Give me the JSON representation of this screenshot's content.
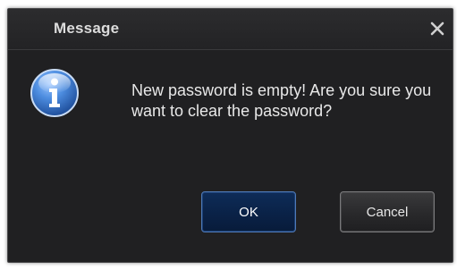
{
  "dialog": {
    "title": "Message",
    "message": "New password is empty! Are you sure you want to clear the password?",
    "icon": "info-icon",
    "close_icon": "close-icon",
    "buttons": {
      "ok_label": "OK",
      "cancel_label": "Cancel"
    }
  },
  "colors": {
    "background": "#202022",
    "title_text": "#dcdcdc",
    "message_text": "#e8e8e8",
    "ok_button": "#0a2247",
    "ok_border": "#4f79b6",
    "cancel_button": "#29292b",
    "info_icon_blue": "#3f7fd0"
  }
}
